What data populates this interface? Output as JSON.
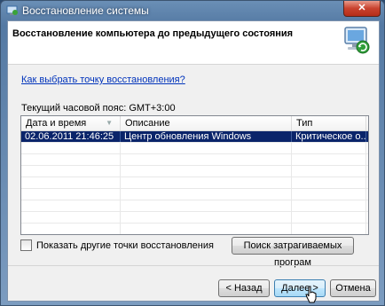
{
  "window": {
    "title": "Восстановление системы",
    "close_label": "✕"
  },
  "header": {
    "heading": "Восстановление компьютера до предыдущего состояния"
  },
  "help_link": "Как выбрать точку восстановления?",
  "timezone_label": "Текущий часовой пояс: GMT+3:00",
  "table": {
    "columns": [
      "Дата и время",
      "Описание",
      "Тип"
    ],
    "rows": [
      {
        "datetime": "02.06.2011 21:46:25",
        "description": "Центр обновления Windows",
        "type": "Критическое о..."
      }
    ]
  },
  "show_more_label": "Показать другие точки восстановления",
  "scan_button": "Поиск затрагиваемых програм",
  "buttons": {
    "back": "< Назад",
    "next": "Далее >",
    "cancel": "Отмена"
  },
  "colors": {
    "selection": "#0a246a",
    "link": "#0033bb"
  }
}
